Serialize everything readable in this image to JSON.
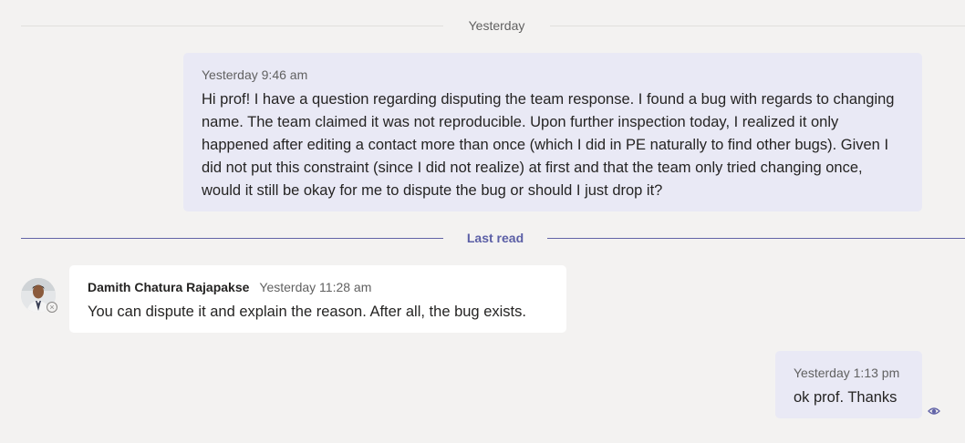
{
  "dividers": {
    "date_label": "Yesterday",
    "last_read_label": "Last read"
  },
  "messages": [
    {
      "direction": "outgoing",
      "timestamp": "Yesterday 9:46 am",
      "text": "Hi prof! I have a question regarding disputing the team response. I found a bug with regards to changing name. The team claimed it was not reproducible. Upon further inspection today, I realized it only happened after editing a contact more than once (which I did in PE naturally to find other bugs). Given I did not put this constraint (since I did not realize) at first and that the team only tried changing once, would it still be okay for me to dispute the bug or should I just drop it?"
    },
    {
      "direction": "incoming",
      "sender": "Damith Chatura Rajapakse",
      "timestamp": "Yesterday 11:28 am",
      "text": "You can dispute it and explain the reason. After all, the bug exists.",
      "avatar_icon": "user-photo-avatar",
      "status_icon": "offline-status-icon"
    },
    {
      "direction": "outgoing",
      "timestamp": "Yesterday 1:13 pm",
      "text": "ok prof. Thanks",
      "read_receipt_icon": "seen-eye-icon"
    }
  ],
  "colors": {
    "background": "#f3f2f1",
    "outgoing_bubble": "#e9e9f5",
    "incoming_bubble": "#ffffff",
    "accent": "#6264a7"
  }
}
